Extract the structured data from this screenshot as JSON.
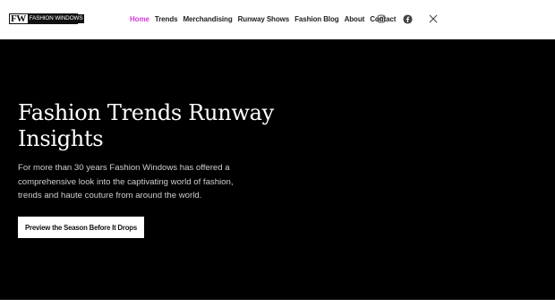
{
  "logo": {
    "mark": "FW",
    "text": "FASHION WINDOWS"
  },
  "nav": {
    "items": [
      {
        "label": "Home",
        "active": true
      },
      {
        "label": "Trends",
        "active": false
      },
      {
        "label": "Merchandising",
        "active": false
      },
      {
        "label": "Runway Shows",
        "active": false
      },
      {
        "label": "Fashion Blog",
        "active": false
      },
      {
        "label": "About",
        "active": false
      },
      {
        "label": "Contact",
        "active": false
      }
    ]
  },
  "social": {
    "icons": [
      "instagram-icon",
      "facebook-icon",
      "x-icon"
    ]
  },
  "hero": {
    "title": "Fashion Trends Runway Insights",
    "description": "For more than 30 years Fashion Windows has offered a comprehensive look into the captivating world of fashion, trends and haute couture from around the world.",
    "cta_label": "Preview the Season Before It Drops"
  },
  "colors": {
    "accent": "#d63ad9",
    "hero_background": "#000000",
    "header_background": "#ffffff"
  }
}
